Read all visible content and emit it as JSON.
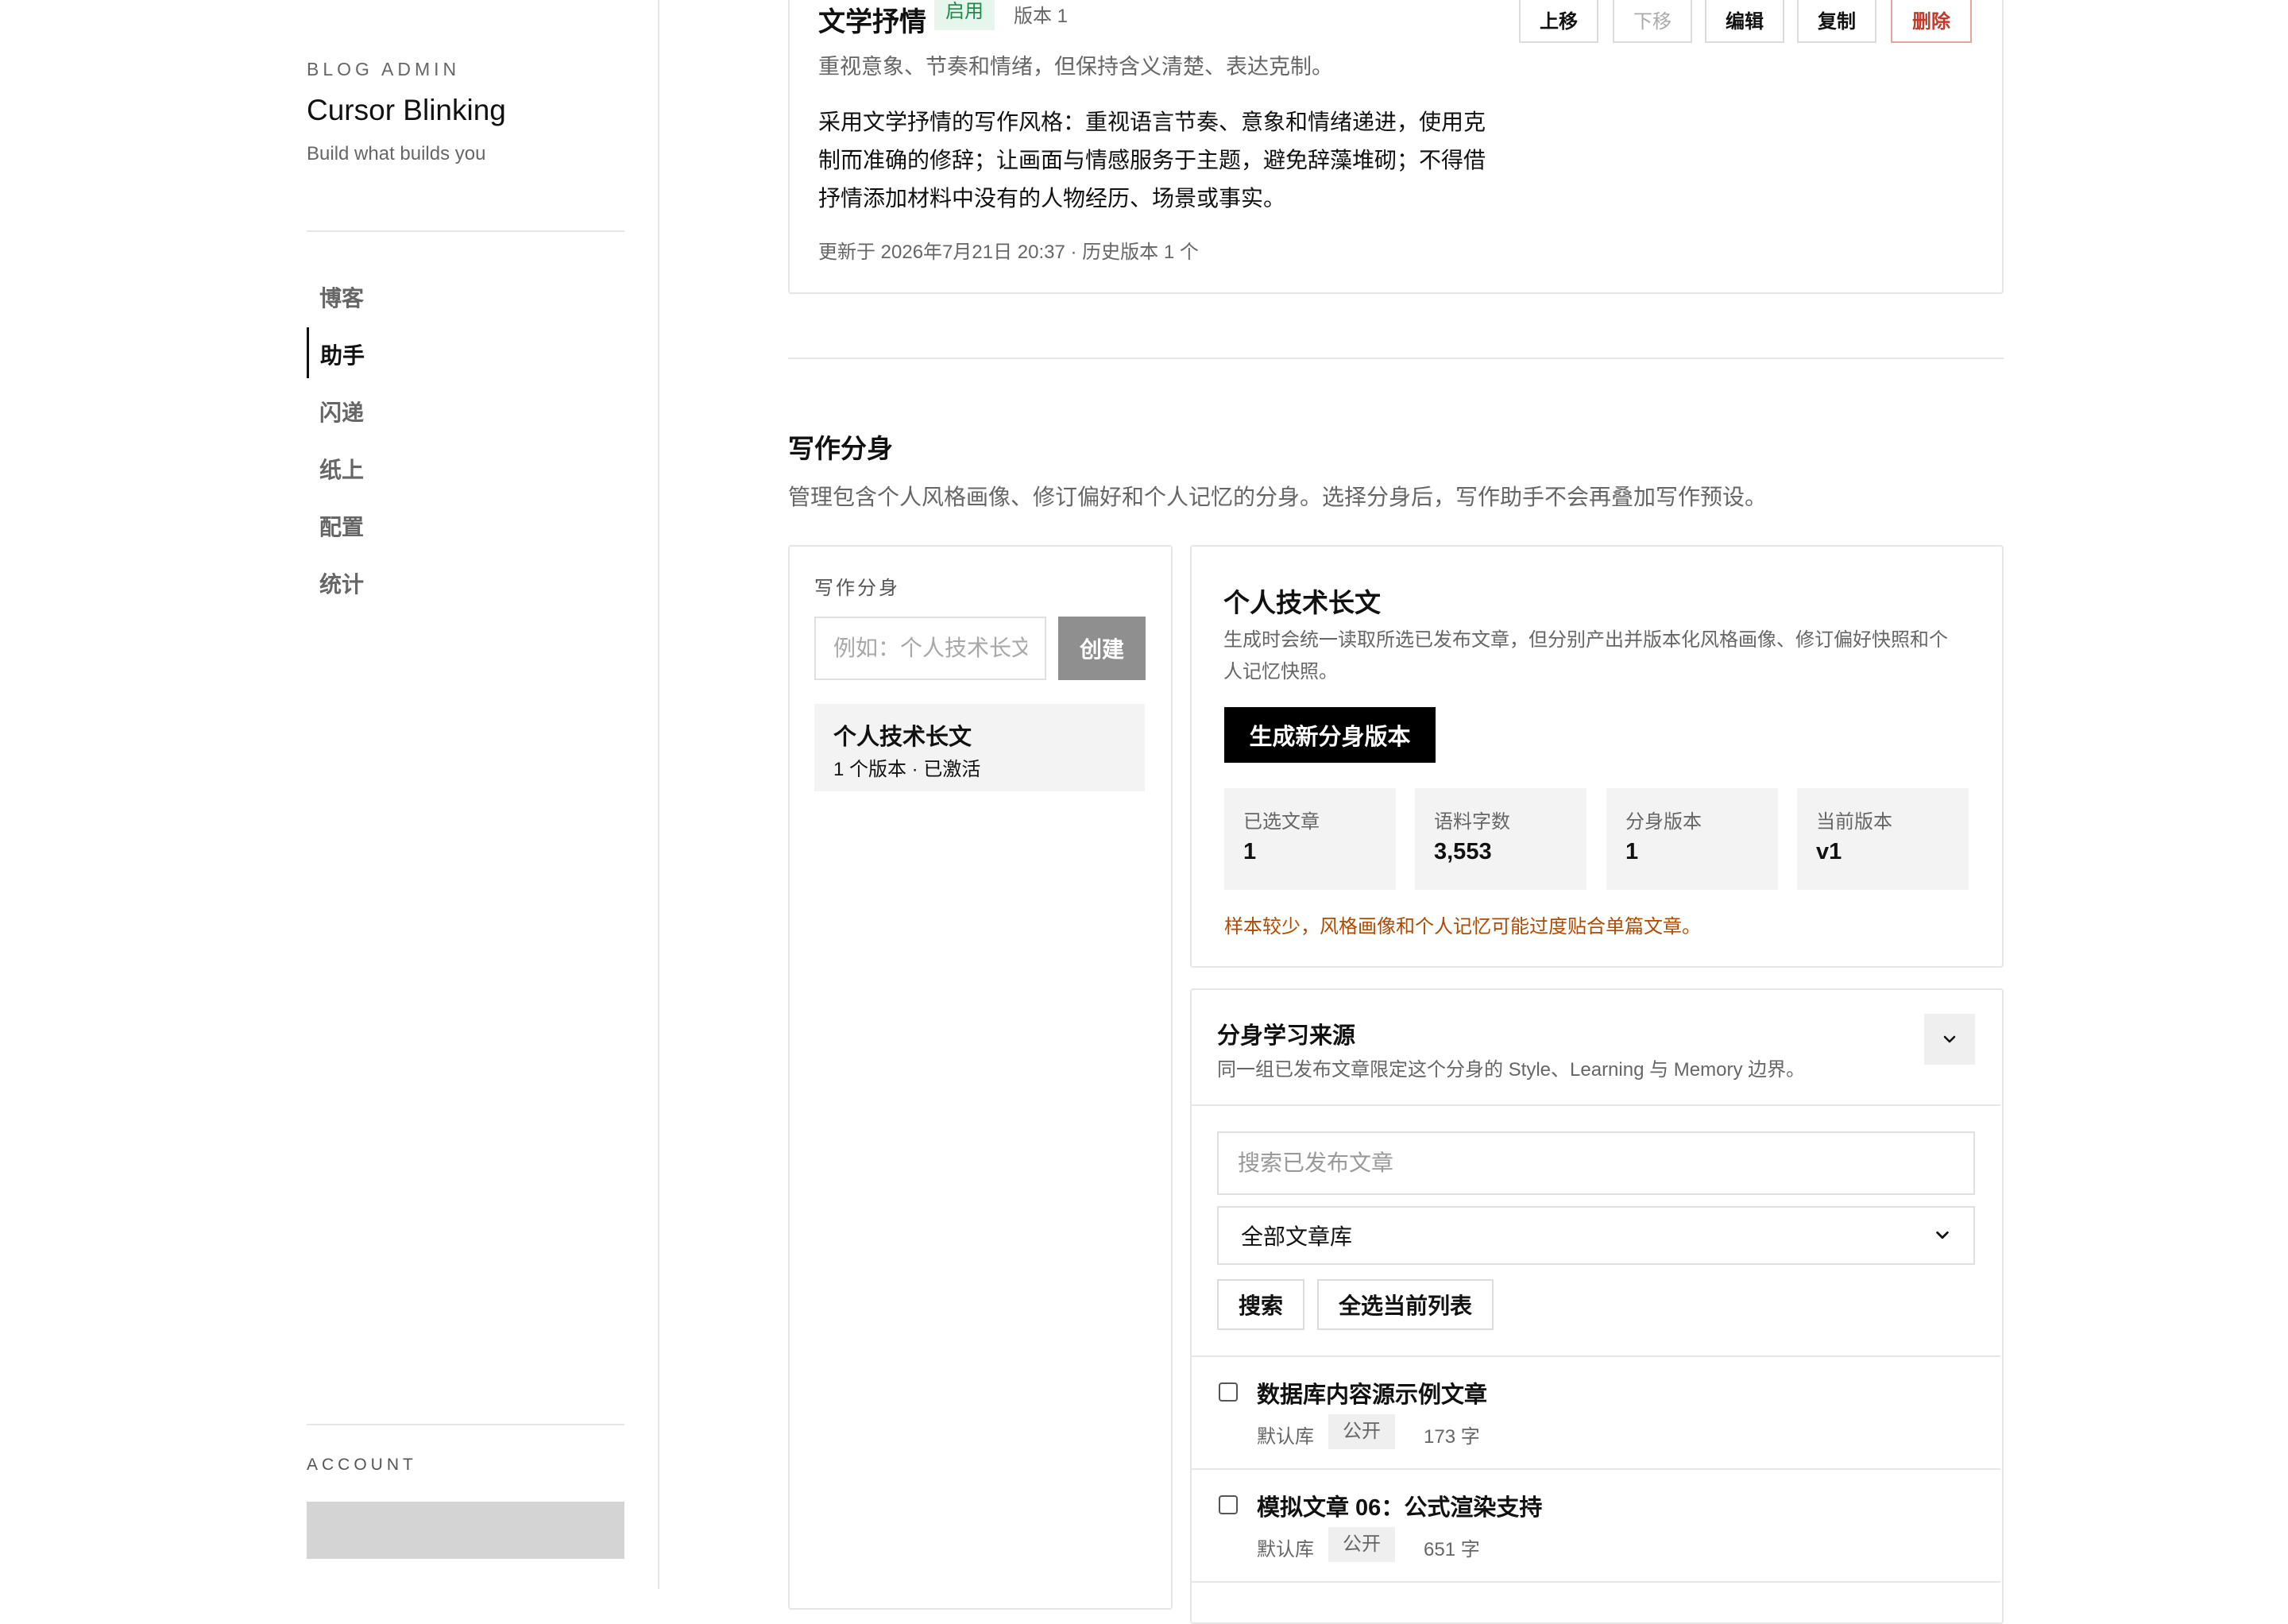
{
  "sidebar": {
    "eyebrow": "BLOG ADMIN",
    "title": "Cursor Blinking",
    "subtitle": "Build what builds you",
    "nav": [
      {
        "label": "博客"
      },
      {
        "label": "助手"
      },
      {
        "label": "闪递"
      },
      {
        "label": "纸上"
      },
      {
        "label": "配置"
      },
      {
        "label": "统计"
      }
    ],
    "active_nav": "助手",
    "account_label": "ACCOUNT"
  },
  "preset": {
    "title": "文学抒情",
    "status": "启用",
    "version": "版本 1",
    "buttons": {
      "up": "上移",
      "down": "下移",
      "edit": "编辑",
      "copy": "复制",
      "delete": "删除"
    },
    "description": "重视意象、节奏和情绪，但保持含义清楚、表达克制。",
    "body_lines": [
      "采用文学抒情的写作风格：重视语言节奏、意象和情绪递进，使用克",
      "制而准确的修辞；让画面与情感服务于主题，避免辞藻堆砌；不得借",
      "抒情添加材料中没有的人物经历、场景或事实。"
    ],
    "meta": "更新于 2026年7月21日 20:37 · 历史版本 1 个"
  },
  "section": {
    "title": "写作分身",
    "description": "管理包含个人风格画像、修订偏好和个人记忆的分身。选择分身后，写作助手不会再叠加写作预设。"
  },
  "persona_list": {
    "label": "写作分身",
    "name_placeholder": "例如：个人技术长文",
    "create_label": "创建",
    "items": [
      {
        "name": "个人技术长文",
        "summary": "1 个版本 · 已激活"
      }
    ]
  },
  "persona_detail": {
    "title": "个人技术长文",
    "description_lines": [
      "生成时会统一读取所选已发布文章，但分别产出并版本化风格画像、修订偏好快照和个",
      "人记忆快照。"
    ],
    "generate_label": "生成新分身版本",
    "stats": [
      {
        "label": "已选文章",
        "value": "1"
      },
      {
        "label": "语料字数",
        "value": "3,553"
      },
      {
        "label": "分身版本",
        "value": "1"
      },
      {
        "label": "当前版本",
        "value": "v1"
      }
    ],
    "warning": "样本较少，风格画像和个人记忆可能过度贴合单篇文章。"
  },
  "sources": {
    "title": "分身学习来源",
    "description": "同一组已发布文章限定这个分身的 Style、Learning 与 Memory 边界。",
    "search_placeholder": "搜索已发布文章",
    "library_selected": "全部文章库",
    "search_label": "搜索",
    "select_all_label": "全选当前列表",
    "articles": [
      {
        "title": "数据库内容源示例文章",
        "library": "默认库",
        "visibility": "公开",
        "count": "173 字",
        "checked": false
      },
      {
        "title": "模拟文章 06：公式渲染支持",
        "library": "默认库",
        "visibility": "公开",
        "count": "651 字",
        "checked": false
      }
    ]
  },
  "colors": {
    "accent": "#000000",
    "enabled_badge_bg": "#e6f6ec",
    "enabled_badge_text": "#1f8a49",
    "danger": "#c0392b",
    "warning": "#b04a00"
  }
}
